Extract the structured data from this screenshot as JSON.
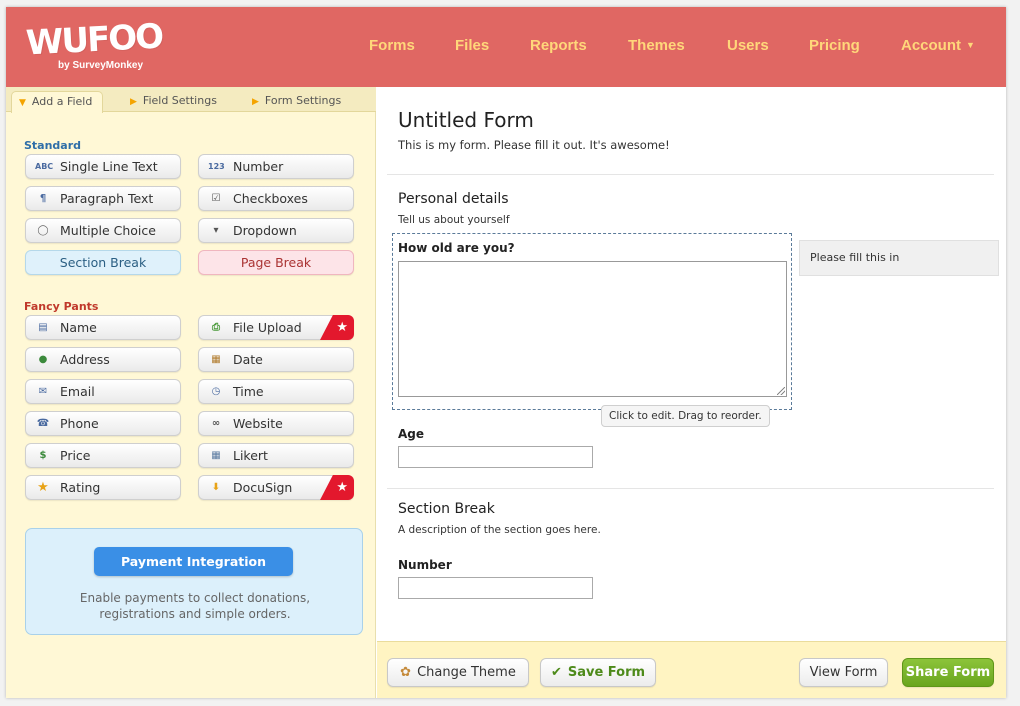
{
  "logo": {
    "main": "WUFOO",
    "sub": "by SurveyMonkey"
  },
  "nav": {
    "items": [
      "Forms",
      "Files",
      "Reports",
      "Themes",
      "Users",
      "Pricing",
      "Account"
    ]
  },
  "tabs": [
    "Add a Field",
    "Field Settings",
    "Form Settings"
  ],
  "standard": {
    "label": "Standard",
    "fields": [
      {
        "label": "Single Line Text",
        "icon": "abc-icon",
        "glyph": "ABC"
      },
      {
        "label": "Number",
        "icon": "number-icon",
        "glyph": "123"
      },
      {
        "label": "Paragraph Text",
        "icon": "paragraph-icon",
        "glyph": "¶"
      },
      {
        "label": "Checkboxes",
        "icon": "checkbox-icon",
        "glyph": "☑"
      },
      {
        "label": "Multiple Choice",
        "icon": "radio-icon",
        "glyph": "◯"
      },
      {
        "label": "Dropdown",
        "icon": "dropdown-icon",
        "glyph": "▾"
      },
      {
        "label": "Section Break"
      },
      {
        "label": "Page Break"
      }
    ]
  },
  "fancy": {
    "label": "Fancy Pants",
    "fields": [
      {
        "label": "Name",
        "icon": "name-card-icon",
        "glyph": "▤"
      },
      {
        "label": "File Upload",
        "icon": "file-upload-icon",
        "glyph": "⎙"
      },
      {
        "label": "Address",
        "icon": "globe-icon",
        "glyph": "●"
      },
      {
        "label": "Date",
        "icon": "calendar-icon",
        "glyph": "▦"
      },
      {
        "label": "Email",
        "icon": "envelope-icon",
        "glyph": "✉"
      },
      {
        "label": "Time",
        "icon": "clock-icon",
        "glyph": "◷"
      },
      {
        "label": "Phone",
        "icon": "phone-icon",
        "glyph": "☎"
      },
      {
        "label": "Website",
        "icon": "link-icon",
        "glyph": "∞"
      },
      {
        "label": "Price",
        "icon": "money-icon",
        "glyph": "$"
      },
      {
        "label": "Likert",
        "icon": "likert-grid-icon",
        "glyph": "▦"
      },
      {
        "label": "Rating",
        "icon": "star-icon",
        "glyph": "★"
      },
      {
        "label": "DocuSign",
        "icon": "docusign-icon",
        "glyph": "⬇"
      }
    ],
    "badge": "★"
  },
  "payment": {
    "button": "Payment Integration",
    "text": "Enable payments to collect donations, registrations and simple orders."
  },
  "form": {
    "title": "Untitled Form",
    "description": "This is my form. Please fill it out. It's awesome!",
    "section1": {
      "title": "Personal details",
      "description": "Tell us about yourself"
    },
    "field_how_old": {
      "label": "How old are you?",
      "instructions": "Please fill this in"
    },
    "tooltip": "Click to edit. Drag to reorder.",
    "field_age": {
      "label": "Age"
    },
    "section2": {
      "title": "Section Break",
      "description": "A description of the section goes here."
    },
    "field_number": {
      "label": "Number"
    }
  },
  "bottom": {
    "change_theme": "Change Theme",
    "save_form": "Save Form",
    "view_form": "View Form",
    "share_form": "Share Form"
  },
  "colors": {
    "header": "#e06763",
    "nav_text": "#ffd77a",
    "panel": "#fff8d6",
    "standard_label": "#2f6ea8",
    "fancy_label": "#c0392b",
    "share": "#7ab52c",
    "payment_button": "#3a8fe6"
  }
}
